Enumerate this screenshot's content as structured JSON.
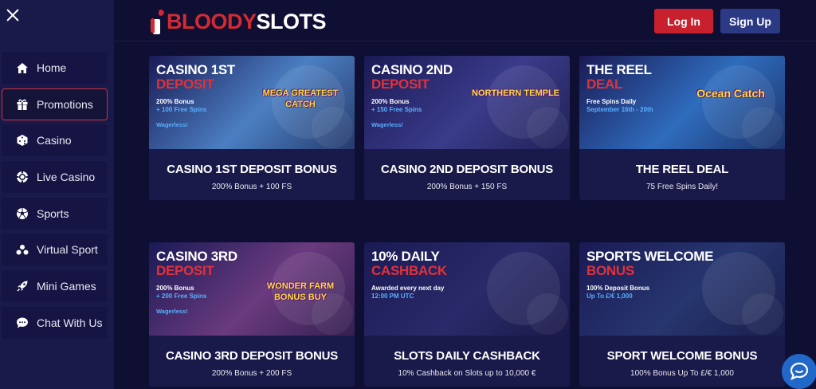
{
  "logo": {
    "part1": "BLOODY",
    "part2": "SLOTS"
  },
  "header": {
    "login_label": "Log In",
    "signup_label": "Sign Up"
  },
  "sidebar": {
    "items": [
      {
        "label": "Home",
        "icon": "home-icon"
      },
      {
        "label": "Promotions",
        "icon": "gift-icon",
        "active": true
      },
      {
        "label": "Casino",
        "icon": "dice-icon"
      },
      {
        "label": "Live Casino",
        "icon": "chip-icon"
      },
      {
        "label": "Sports",
        "icon": "soccer-ball-icon"
      },
      {
        "label": "Virtual Sport",
        "icon": "virtual-sport-icon"
      },
      {
        "label": "Mini Games",
        "icon": "rocket-icon"
      },
      {
        "label": "Chat With Us",
        "icon": "chat-icon"
      }
    ]
  },
  "promotions": [
    {
      "banner_title_1": "CASINO 1ST",
      "banner_title_2": "DEPOSIT",
      "banner_line_1": "200% Bonus",
      "banner_line_2": "+ 100 Free Spins",
      "banner_extra": "Wagerless!",
      "banner_art": "MEGA GREATEST CATCH",
      "title": "CASINO 1ST DEPOSIT BONUS",
      "desc": "200% Bonus + 100 FS",
      "bg": "#4b7fc2"
    },
    {
      "banner_title_1": "CASINO 2ND",
      "banner_title_2": "DEPOSIT",
      "banner_line_1": "200% Bonus",
      "banner_line_2": "+ 150 Free Spins",
      "banner_extra": "Wagerless!",
      "banner_art": "NORTHERN TEMPLE",
      "title": "CASINO 2ND DEPOSIT BONUS",
      "desc": "200% Bonus + 150 FS",
      "bg": "#3a3b8a"
    },
    {
      "banner_title_1": "THE REEL",
      "banner_title_2": "DEAL",
      "banner_line_1": "Free Spins Daily",
      "banner_line_2": "September 16th - 20th",
      "banner_extra": "",
      "banner_art": "Ocean Catch",
      "title": "THE REEL DEAL",
      "desc": "75 Free Spins Daily!",
      "bg": "#2f6cbd"
    },
    {
      "banner_title_1": "CASINO 3RD",
      "banner_title_2": "DEPOSIT",
      "banner_line_1": "200% Bonus",
      "banner_line_2": "+ 200 Free Spins",
      "banner_extra": "Wagerless!",
      "banner_art": "WONDER FARM BONUS BUY",
      "title": "CASINO 3RD DEPOSIT BONUS",
      "desc": "200% Bonus + 200 FS",
      "bg": "#6a3a7e"
    },
    {
      "banner_title_1": "10% DAILY",
      "banner_title_2": "CASHBACK",
      "banner_line_1": "Awarded every next day",
      "banner_line_2": "12:00 PM UTC",
      "banner_extra": "",
      "banner_art": "",
      "title": "SLOTS DAILY CASHBACK",
      "desc": "10% Cashback on Slots up to 10,000 €",
      "bg": "#2a2a6a"
    },
    {
      "banner_title_1": "SPORTS WELCOME",
      "banner_title_2": "BONUS",
      "banner_line_1": "100% Deposit Bonus",
      "banner_line_2": "Up To £/€ 1,000",
      "banner_extra": "",
      "banner_art": "",
      "title": "SPORT WELCOME BONUS",
      "desc": "100% Bonus Up To £/€ 1,000",
      "bg": "#27366f"
    }
  ]
}
